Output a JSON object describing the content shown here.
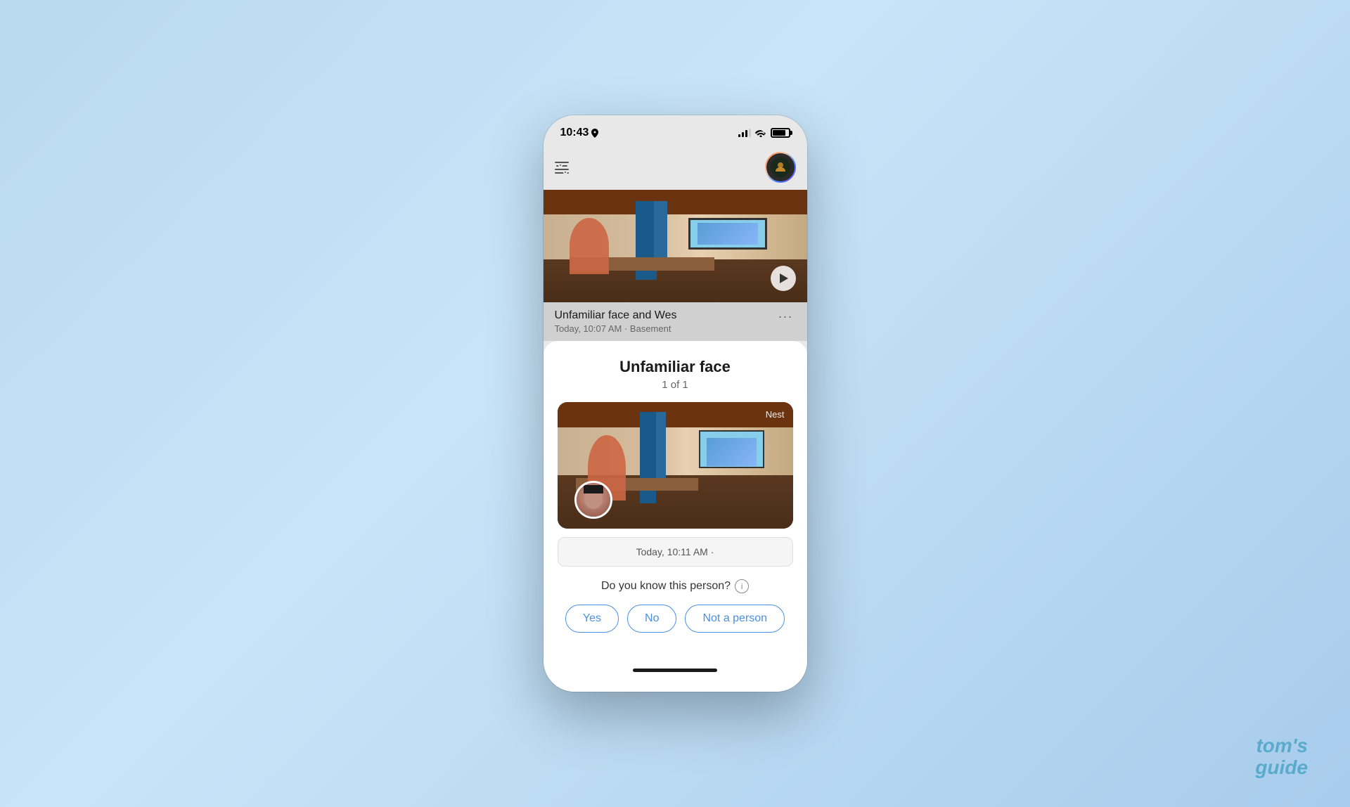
{
  "watermark": {
    "line1": "tom's",
    "line2": "guide"
  },
  "status_bar": {
    "time": "10:43",
    "has_location": true
  },
  "app_header": {
    "filter_icon_label": "filter-icon",
    "avatar_label": "user-avatar"
  },
  "video_card": {
    "title": "Unfamiliar face and Wes",
    "subtitle": "Today, 10:07 AM · Basement",
    "more_options_label": "···"
  },
  "bottom_sheet": {
    "title": "Unfamiliar face",
    "subtitle": "1 of 1",
    "nest_label": "Nest",
    "timestamp": "Today, 10:11 AM",
    "timestamp_dot": "·",
    "question": "Do you know this person?",
    "buttons": {
      "yes": "Yes",
      "no": "No",
      "not_a_person": "Not a person"
    }
  }
}
